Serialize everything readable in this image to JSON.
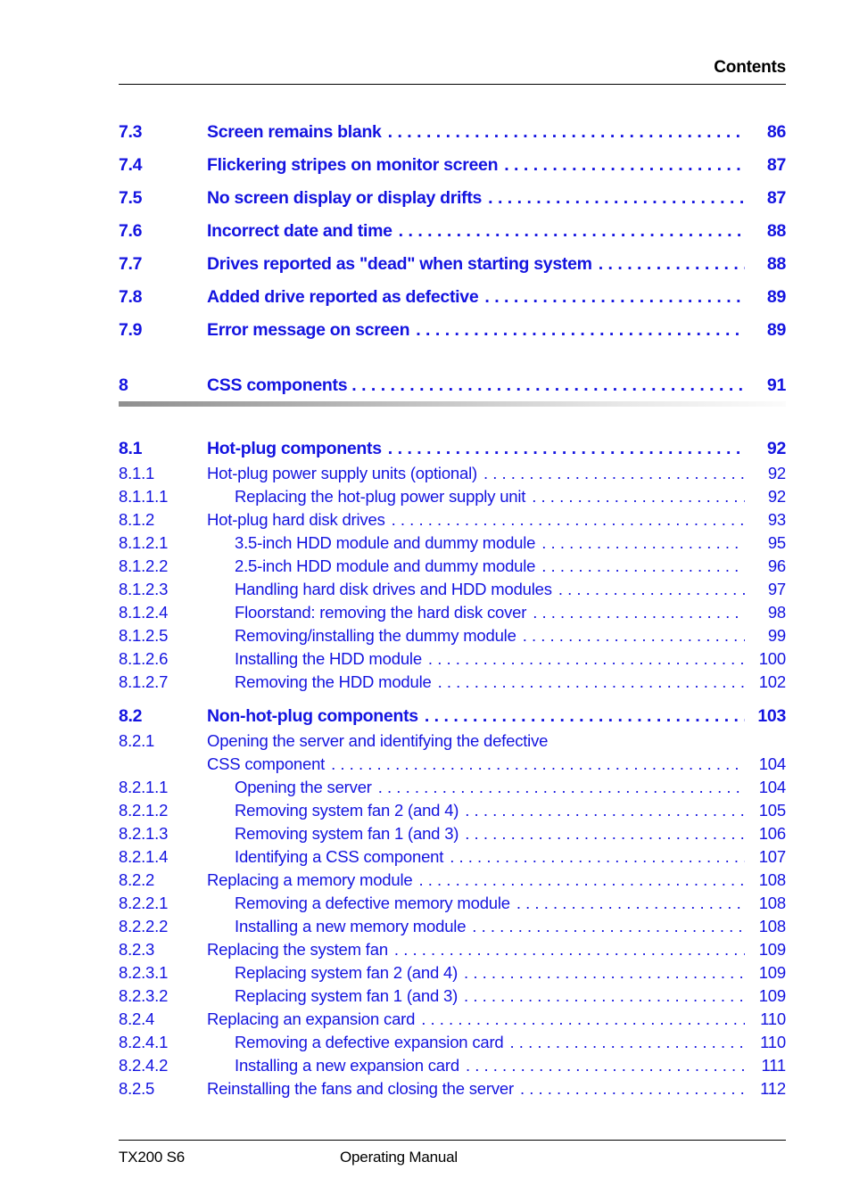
{
  "header": {
    "title": "Contents"
  },
  "footer": {
    "left": "TX200 S6",
    "center": "Operating Manual"
  },
  "leader_dot": ". ",
  "toc": {
    "entries": [
      {
        "level": 2,
        "num": "7.3",
        "title": "Screen remains blank",
        "page": "86"
      },
      {
        "level": 2,
        "num": "7.4",
        "title": "Flickering stripes on monitor screen",
        "page": "87"
      },
      {
        "level": 2,
        "num": "7.5",
        "title": "No screen display or display drifts",
        "page": "87"
      },
      {
        "level": 2,
        "num": "7.6",
        "title": "Incorrect date and time",
        "page": "88"
      },
      {
        "level": 2,
        "num": "7.7",
        "title": "Drives reported as \"dead\" when starting system",
        "page": "88"
      },
      {
        "level": 2,
        "num": "7.8",
        "title": "Added drive reported as defective",
        "page": "89"
      },
      {
        "level": 2,
        "num": "7.9",
        "title": "Error message on screen",
        "page": "89"
      },
      {
        "level": 1,
        "num": "8",
        "title": "CSS components",
        "page": "91"
      },
      {
        "level": 2,
        "num": "8.1",
        "title": "Hot-plug components",
        "page": "92"
      },
      {
        "level": 3,
        "num": "8.1.1",
        "title": "Hot-plug power supply units (optional)",
        "page": "92"
      },
      {
        "level": 4,
        "num": "8.1.1.1",
        "title": "Replacing the hot-plug power supply unit",
        "page": "92"
      },
      {
        "level": 3,
        "num": "8.1.2",
        "title": "Hot-plug hard disk drives",
        "page": "93"
      },
      {
        "level": 4,
        "num": "8.1.2.1",
        "title": "3.5-inch HDD module and dummy module",
        "page": "95"
      },
      {
        "level": 4,
        "num": "8.1.2.2",
        "title": "2.5-inch HDD module and dummy module",
        "page": "96"
      },
      {
        "level": 4,
        "num": "8.1.2.3",
        "title": "Handling hard disk drives and HDD modules",
        "page": "97"
      },
      {
        "level": 4,
        "num": "8.1.2.4",
        "title": "Floorstand: removing the hard disk cover",
        "page": "98"
      },
      {
        "level": 4,
        "num": "8.1.2.5",
        "title": "Removing/installing the dummy module",
        "page": "99"
      },
      {
        "level": 4,
        "num": "8.1.2.6",
        "title": "Installing the HDD module",
        "page": "100"
      },
      {
        "level": 4,
        "num": "8.1.2.7",
        "title": "Removing the HDD module",
        "page": "102"
      },
      {
        "level": 2,
        "num": "8.2",
        "title": "Non-hot-plug components",
        "page": "103"
      },
      {
        "level": 3,
        "num": "8.2.1",
        "title": "Opening the server and identifying the defective",
        "title_cont": "CSS component",
        "page": "104"
      },
      {
        "level": 4,
        "num": "8.2.1.1",
        "title": "Opening the server",
        "page": "104"
      },
      {
        "level": 4,
        "num": "8.2.1.2",
        "title": "Removing system fan 2 (and 4)",
        "page": "105"
      },
      {
        "level": 4,
        "num": "8.2.1.3",
        "title": "Removing system fan 1 (and 3)",
        "page": "106"
      },
      {
        "level": 4,
        "num": "8.2.1.4",
        "title": "Identifying a CSS component",
        "page": "107"
      },
      {
        "level": 3,
        "num": "8.2.2",
        "title": "Replacing a memory module",
        "page": "108"
      },
      {
        "level": 4,
        "num": "8.2.2.1",
        "title": "Removing a defective memory module",
        "page": "108"
      },
      {
        "level": 4,
        "num": "8.2.2.2",
        "title": "Installing a new memory module",
        "page": "108"
      },
      {
        "level": 3,
        "num": "8.2.3",
        "title": "Replacing the system fan",
        "page": "109"
      },
      {
        "level": 4,
        "num": "8.2.3.1",
        "title": "Replacing system fan 2 (and 4)",
        "page": "109"
      },
      {
        "level": 4,
        "num": "8.2.3.2",
        "title": "Replacing system fan 1 (and 3)",
        "page": "109"
      },
      {
        "level": 3,
        "num": "8.2.4",
        "title": "Replacing an expansion card",
        "page": "110"
      },
      {
        "level": 4,
        "num": "8.2.4.1",
        "title": "Removing a defective expansion card",
        "page": "110"
      },
      {
        "level": 4,
        "num": "8.2.4.2",
        "title": "Installing a new expansion card",
        "page": "111"
      },
      {
        "level": 3,
        "num": "8.2.5",
        "title": "Reinstalling the fans and closing the server",
        "page": "112"
      }
    ]
  },
  "colors": {
    "link": "#1414e0",
    "text": "#000000",
    "rule": "#000000",
    "chapter_bar_start": "#8f8f8f",
    "chapter_bar_end": "#fbfbfb"
  }
}
